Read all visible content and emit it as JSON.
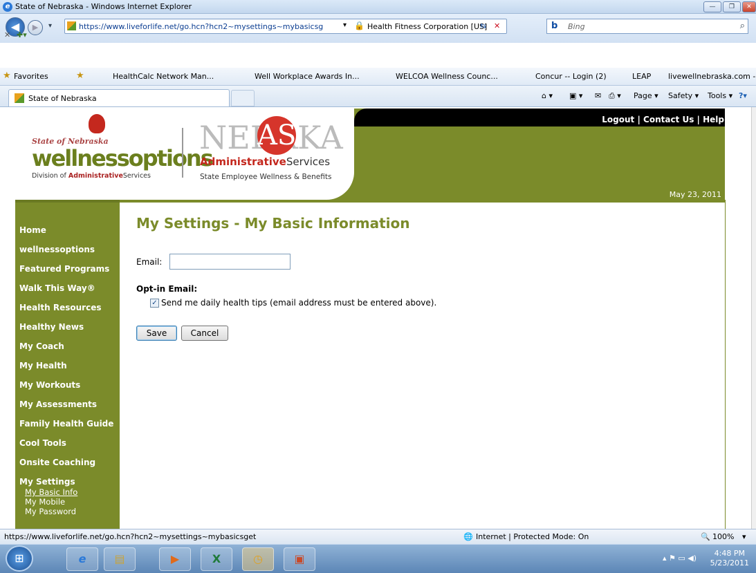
{
  "window": {
    "title": "State of Nebraska - Windows Internet Explorer",
    "minimize_glyph": "—",
    "maximize_glyph": "❐",
    "close_glyph": "✕"
  },
  "address_bar": {
    "url": "https://www.liveforlife.net/go.hcn?hcn2~mysettings~mybasicsg",
    "cert": "Health Fitness Corporation [US]",
    "dropdown_glyph": "▾",
    "lock_glyph": "🔒",
    "refresh_glyph": "⇆",
    "stop_glyph": "✕"
  },
  "search": {
    "logo": "b",
    "placeholder": "Bing",
    "go_glyph": "⌕"
  },
  "menu_row": {
    "close_glyph": "✕",
    "compat_glyph": "✚▾"
  },
  "favorites_bar": {
    "favorites_label": "Favorites",
    "items": [
      "HealthCalc Network Man...",
      "Well Workplace Awards In...",
      "WELCOA  Wellness Counc...",
      "Concur -- Login (2)",
      "LEAP",
      "livewellnebraska.com - Br..."
    ]
  },
  "tab": {
    "title": "State of Nebraska"
  },
  "command_bar": {
    "home_glyph": "⌂ ▾",
    "feeds_glyph": "▣ ▾",
    "mail_glyph": "✉",
    "print_glyph": "⎙ ▾",
    "page": "Page ▾",
    "safety": "Safety ▾",
    "tools": "Tools ▾",
    "help": "?▾"
  },
  "header": {
    "links": [
      "Logout",
      "Contact Us",
      "Help"
    ],
    "separator": " | ",
    "date": "May 23, 2011",
    "logo_wo_state": "State of Nebraska",
    "logo_wo_word": "wellnessoptions",
    "logo_wo_sub_prefix": "Division of ",
    "logo_wo_sub_bold": "Administrative",
    "logo_wo_sub_suffix": "Services",
    "logo_ne_word_left": "NEBR",
    "logo_ne_circle": "AS",
    "logo_ne_word_right": "KA",
    "logo_ne_admin_bold": "Administrative",
    "logo_ne_admin_rest": "Services",
    "logo_ne_sub": "State Employee Wellness & Benefits"
  },
  "nav": {
    "items": [
      "Home",
      "wellnessoptions",
      "Featured Programs",
      "Walk This Way®",
      "Health Resources",
      "Healthy News",
      "My Coach",
      "My Health",
      "My Workouts",
      "My Assessments",
      "Family Health Guide",
      "Cool Tools",
      "Onsite Coaching",
      "My Settings"
    ],
    "sub_items": [
      "My Basic Info",
      "My Mobile",
      "My Password"
    ]
  },
  "main": {
    "title": "My Settings - My Basic Information",
    "email_label": "Email:",
    "email_value": "",
    "optin_label": "Opt-in Email:",
    "optin_checked": true,
    "optin_check_glyph": "✓",
    "optin_text": "Send me daily health tips (email address must be entered above).",
    "save": "Save",
    "cancel": "Cancel"
  },
  "status_bar": {
    "url": "https://www.liveforlife.net/go.hcn?hcn2~mysettings~mybasicsget",
    "zone": "Internet | Protected Mode: On",
    "zone_glyph": "🌐",
    "zoom_glyph": "🔍",
    "zoom": "100%",
    "dropdown_glyph": "▾"
  },
  "taskbar": {
    "start_glyph": "⊞",
    "time": "4:48 PM",
    "date": "5/23/2011",
    "tray_glyphs": "▴  ⚑  ▭  ◀)",
    "apps": [
      {
        "glyph": "e",
        "color": "#2b79d8"
      },
      {
        "glyph": "▤",
        "color": "#c8a33a"
      },
      {
        "glyph": "▶",
        "color": "#e06a1a"
      },
      {
        "glyph": "X",
        "color": "#1f7a3a"
      },
      {
        "glyph": "◷",
        "color": "#e0a020"
      },
      {
        "glyph": "▣",
        "color": "#c84a2a"
      }
    ]
  },
  "colors": {
    "brand_green": "#7b8b2a",
    "brand_red": "#c4281e"
  }
}
